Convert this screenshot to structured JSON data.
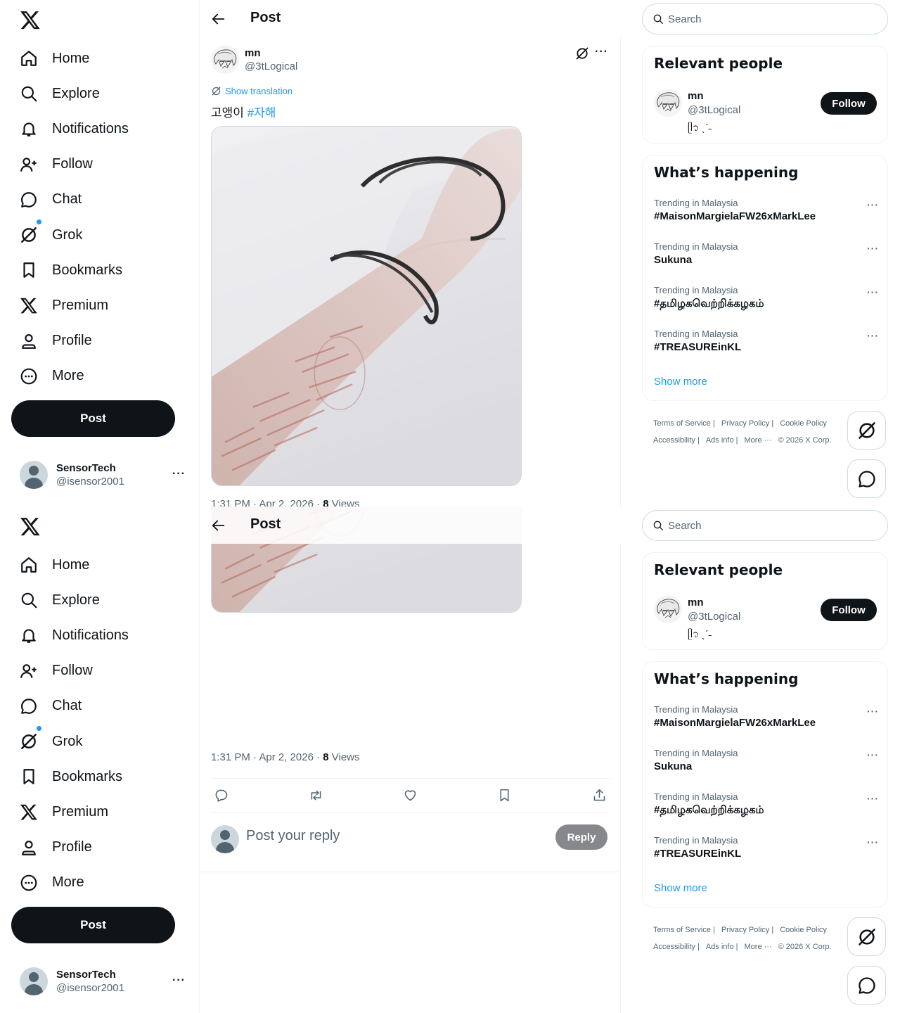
{
  "nav": {
    "items": [
      {
        "label": "Home",
        "icon": "home-icon"
      },
      {
        "label": "Explore",
        "icon": "search-icon"
      },
      {
        "label": "Notifications",
        "icon": "bell-icon"
      },
      {
        "label": "Follow",
        "icon": "person-plus-icon"
      },
      {
        "label": "Chat",
        "icon": "chat-icon"
      },
      {
        "label": "Grok",
        "icon": "grok-icon"
      },
      {
        "label": "Bookmarks",
        "icon": "bookmark-icon"
      },
      {
        "label": "Premium",
        "icon": "x-logo-icon"
      },
      {
        "label": "Profile",
        "icon": "person-icon"
      },
      {
        "label": "More",
        "icon": "more-circle-icon"
      }
    ],
    "post_label": "Post"
  },
  "account": {
    "name": "SensorTech",
    "handle": "@isensor2001",
    "more": "···"
  },
  "header": {
    "title": "Post"
  },
  "tweet": {
    "name": "mn",
    "handle": "@3tLogical",
    "more": "···",
    "translate": "Show translation",
    "text": "고앵이",
    "hashtag": "#자해",
    "time": "1:31 PM · Apr 2, 2026",
    "dot": " · ",
    "views_count": "8",
    "views_label": " Views"
  },
  "reply": {
    "placeholder": "Post your reply",
    "button": "Reply"
  },
  "search": {
    "placeholder": "Search"
  },
  "relevant": {
    "title": "Relevant people",
    "name": "mn",
    "handle": "@3tLogical",
    "bio": "ᥫ᭡ ˎˊ˗",
    "follow": "Follow"
  },
  "happening": {
    "title": "What’s happening",
    "trends": [
      {
        "context": "Trending in Malaysia",
        "name": "#MaisonMargielaFW26xMarkLee"
      },
      {
        "context": "Trending in Malaysia",
        "name": "Sukuna"
      },
      {
        "context": "Trending in Malaysia",
        "name": "#தமிழகவெற்றிக்கழகம்"
      },
      {
        "context": "Trending in Malaysia",
        "name": "#TREASUREinKL"
      }
    ],
    "more": "···",
    "show_more": "Show more"
  },
  "footer": {
    "links": [
      "Terms of Service |",
      "Privacy Policy |",
      "Cookie Policy",
      "Accessibility |",
      "Ads info |",
      "More ···",
      "© 2026 X Corp."
    ]
  },
  "colors": {
    "accent": "#1d9bf0",
    "text": "#0f1419",
    "muted": "#536471"
  }
}
